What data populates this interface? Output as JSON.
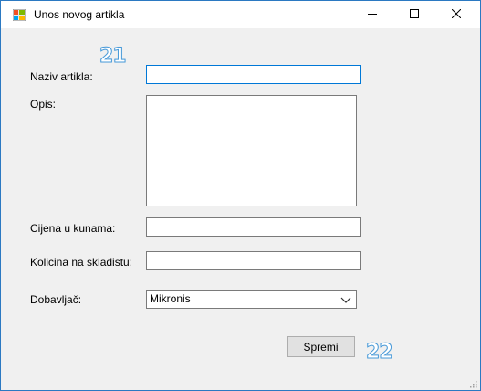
{
  "window": {
    "title": "Unos novog artikla",
    "icon": "windows-form-icon",
    "controls": [
      "minimize-icon",
      "maximize-icon",
      "close-icon"
    ]
  },
  "form": {
    "naziv_label": "Naziv artikla:",
    "naziv_value": "",
    "opis_label": "Opis:",
    "opis_value": "",
    "cijena_label": "Cijena u kunama:",
    "cijena_value": "",
    "kolicina_label": "Kolicina na skladistu:",
    "kolicina_value": "",
    "dobavljac_label": "Dobavljač:",
    "dobavljac_selected": "Mikronis",
    "save_label": "Spremi"
  },
  "annotations": {
    "marker_top": "21",
    "marker_bottom": "22"
  },
  "colors": {
    "title_bar": "#ffffff",
    "window_border": "#2b79c2",
    "client_background": "#f0f0f0",
    "focus_border": "#0078d7",
    "marker_outline": "#4a9bd9"
  }
}
